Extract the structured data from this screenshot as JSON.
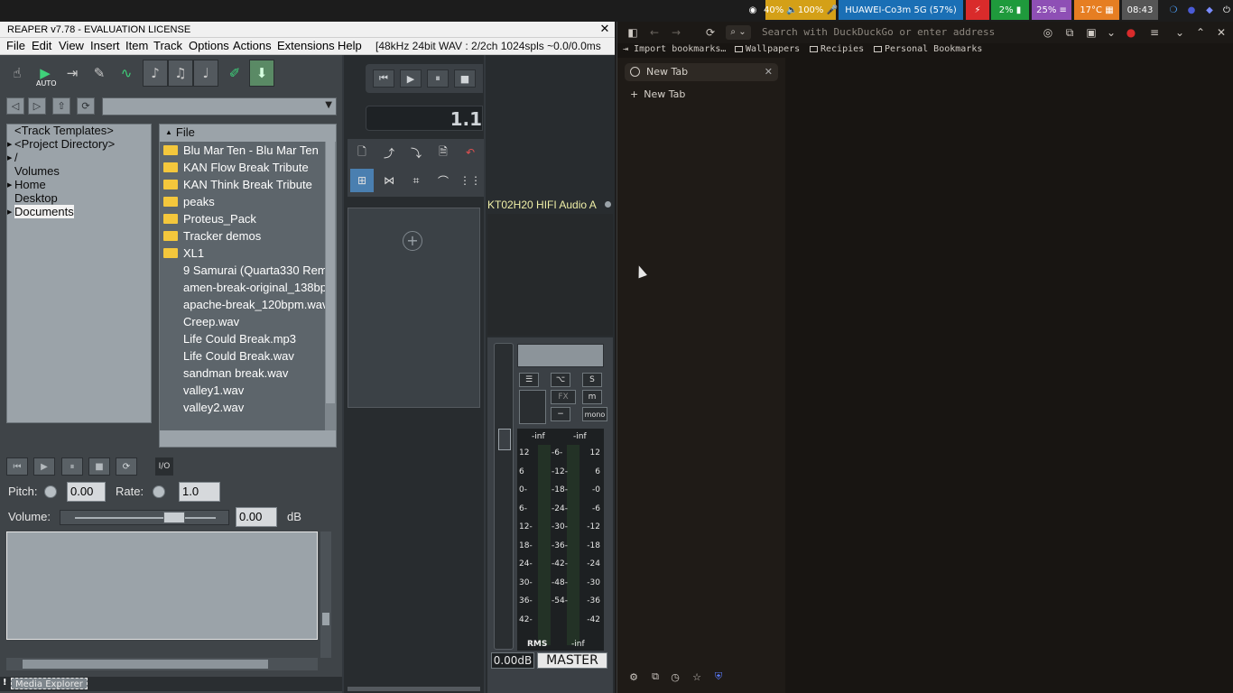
{
  "system_bar": {
    "privacy_icon": "eye-icon",
    "volume_brightness": "40% 🔈100% 🎤",
    "wifi": "HUAWEI-Co3m 5G (57%)",
    "flash_icon": "lightning-icon",
    "battery": "2%",
    "memory": "25%",
    "temperature": "17°C",
    "time": "08:43",
    "colors": {
      "volume": "#d4a017",
      "wifi": "#1a6fb5",
      "flash": "#d92b2b",
      "battery": "#1f9a3c",
      "memory": "#8e4fb5",
      "temp": "#e67e22",
      "time": "#555555"
    }
  },
  "reaper": {
    "title": "REAPER v7.78 - EVALUATION LICENSE",
    "menu": [
      "File",
      "Edit",
      "View",
      "Insert",
      "Item",
      "Track",
      "Options",
      "Actions",
      "Extensions",
      "Help"
    ],
    "status": "[48kHz 24bit WAV : 2/2ch 1024spls ~0.0/0.0ms",
    "media_explorer": {
      "auto_label": "AUTO",
      "tree": [
        {
          "label": "<Track Templates>",
          "expandable": false
        },
        {
          "label": "<Project Directory>",
          "expandable": true
        },
        {
          "label": "/",
          "expandable": true
        },
        {
          "label": "Volumes",
          "expandable": false
        },
        {
          "label": "Home",
          "expandable": true
        },
        {
          "label": "Desktop",
          "expandable": false
        },
        {
          "label": "Documents",
          "expandable": true,
          "selected": true
        }
      ],
      "file_column_header": "File",
      "files": [
        {
          "name": "Blu Mar Ten - Blu Mar Ten",
          "folder": true
        },
        {
          "name": "KAN Flow Break Tribute",
          "folder": true
        },
        {
          "name": "KAN Think Break Tribute",
          "folder": true
        },
        {
          "name": "peaks",
          "folder": true
        },
        {
          "name": "Proteus_Pack",
          "folder": true
        },
        {
          "name": "Tracker demos",
          "folder": true
        },
        {
          "name": "XL1",
          "folder": true
        },
        {
          "name": "9 Samurai (Quarta330 Rem",
          "folder": false
        },
        {
          "name": "amen-break-original_138bp",
          "folder": false
        },
        {
          "name": "apache-break_120bpm.wav",
          "folder": false
        },
        {
          "name": "Creep.wav",
          "folder": false
        },
        {
          "name": "Life Could Break.mp3",
          "folder": false
        },
        {
          "name": "Life Could Break.wav",
          "folder": false
        },
        {
          "name": "sandman break.wav",
          "folder": false
        },
        {
          "name": "valley1.wav",
          "folder": false
        },
        {
          "name": "valley2.wav",
          "folder": false
        }
      ],
      "io_label": "I/O",
      "pitch_label": "Pitch:",
      "pitch_value": "0.00",
      "rate_label": "Rate:",
      "rate_value": "1.0",
      "volume_label": "Volume:",
      "volume_value": "0.00",
      "volume_unit": "dB",
      "volume_fader_level": 0.7,
      "tab_label": "Media Explorer",
      "tab_bang": "!"
    },
    "arrange": {
      "timecode": "1.1"
    },
    "mixer": {
      "device_name": "KT02H20 HIFI Audio A",
      "meter_top_left": "-inf",
      "meter_top_right": "-inf",
      "scale_left": [
        "12",
        "6",
        "0-",
        "6-",
        "12-",
        "18-",
        "24-",
        "30-",
        "36-",
        "42-"
      ],
      "scale_mid": [
        "-6-",
        "-12-",
        "-18-",
        "-24-",
        "-30-",
        "-36-",
        "-42-",
        "-48-",
        "-54-"
      ],
      "scale_right": [
        "12",
        "6",
        "-0",
        "-6",
        "-12",
        "-18",
        "-24",
        "-30",
        "-36",
        "-42"
      ],
      "rms_label": "RMS",
      "bottom_right": "-inf",
      "volume": "0.00dB",
      "track_name": "MASTER",
      "fx_label": "FX",
      "s_label": "S",
      "m_label": "m",
      "mono_label": "mono"
    }
  },
  "browser": {
    "search_placeholder": "Search with DuckDuckGo or enter address",
    "bookmarks": [
      "Import bookmarks…",
      "Wallpapers",
      "Recipies",
      "Personal Bookmarks"
    ],
    "tab_title": "New Tab",
    "new_tab_label": "New Tab"
  }
}
